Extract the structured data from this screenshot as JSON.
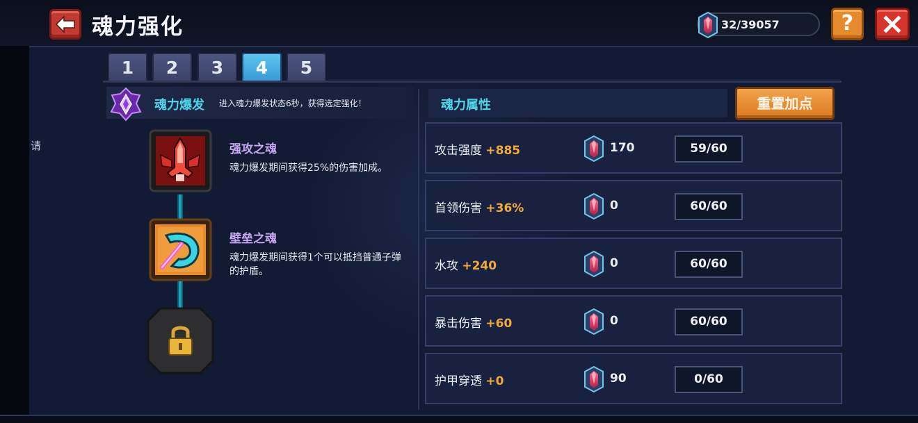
{
  "header": {
    "title": "魂力强化",
    "currency": "32/39057",
    "help_label": "?"
  },
  "side_hint": "请",
  "tabs": [
    {
      "label": "1"
    },
    {
      "label": "2"
    },
    {
      "label": "3"
    },
    {
      "label": "4",
      "active": true
    },
    {
      "label": "5"
    }
  ],
  "burst": {
    "title": "魂力爆发",
    "description": "进入魂力爆发状态6秒，获得选定强化！"
  },
  "skills": [
    {
      "name": "强攻之魂",
      "description": "魂力爆发期间获得25%的伤害加成。",
      "icon": "rocket-icon",
      "state": "unlocked"
    },
    {
      "name": "壁垒之魂",
      "description": "魂力爆发期间获得1个可以抵挡普通子弹的护盾。",
      "icon": "shield-boomerang-icon",
      "state": "unlocked"
    },
    {
      "name": "",
      "description": "",
      "icon": "lock-icon",
      "state": "locked"
    }
  ],
  "attributes_panel": {
    "title": "魂力属性",
    "reset_label": "重置加点"
  },
  "attributes": [
    {
      "name": "攻击强度",
      "bonus": "+885",
      "cost": "170",
      "level": "59/60"
    },
    {
      "name": "首领伤害",
      "bonus": "+36%",
      "cost": "0",
      "level": "60/60"
    },
    {
      "name": "水攻",
      "bonus": "+240",
      "cost": "0",
      "level": "60/60"
    },
    {
      "name": "暴击伤害",
      "bonus": "+60",
      "cost": "0",
      "level": "60/60"
    },
    {
      "name": "护甲穿透",
      "bonus": "+0",
      "cost": "90",
      "level": "0/60"
    }
  ],
  "colors": {
    "accent_cyan": "#4ed6e8",
    "bonus_orange": "#f2a93a",
    "skill_name_purple": "#c9a6f2",
    "panel_bg": "#121a34"
  }
}
